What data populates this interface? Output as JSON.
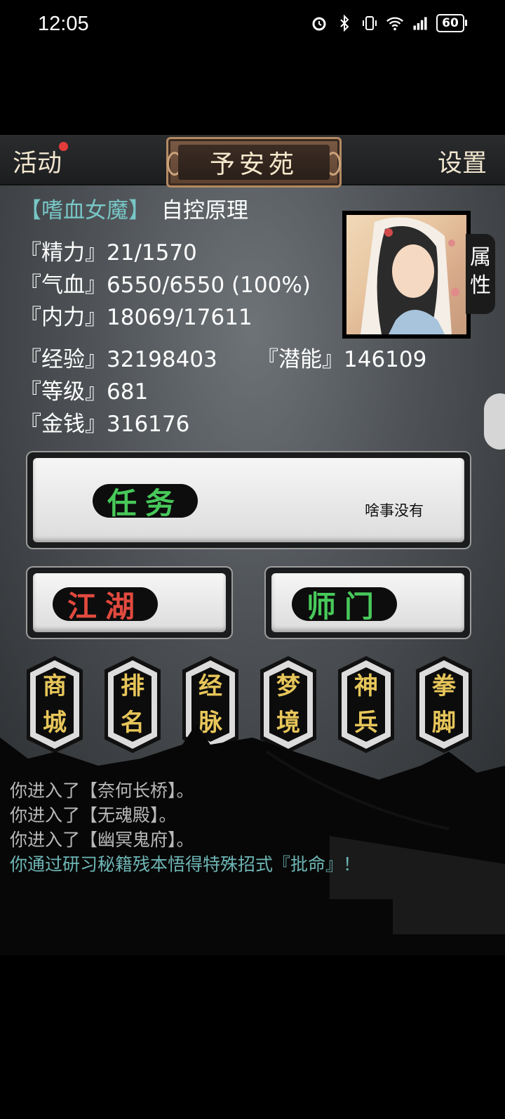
{
  "status_bar": {
    "time": "12:05",
    "battery": "60"
  },
  "topbar": {
    "left": "活动",
    "title": "予安苑",
    "right": "设置"
  },
  "profile": {
    "rank": "【嗜血女魔】",
    "sect": "自控原理",
    "stats": [
      {
        "label": "『精力』",
        "value": "21/1570"
      },
      {
        "label": "『气血』",
        "value": "6550/6550 (100%)"
      },
      {
        "label": "『内力』",
        "value": "18069/17611"
      },
      {
        "label": "『经验』",
        "value": "32198403"
      },
      {
        "label": "『潜能』",
        "value": "146109"
      },
      {
        "label": "『等级』",
        "value": "681"
      },
      {
        "label": "『金钱』",
        "value": "316176"
      }
    ],
    "attr_tab": "属性"
  },
  "task": {
    "label": "任务",
    "note": "啥事没有"
  },
  "buttons": {
    "jianghu": "江湖",
    "shimen": "师门"
  },
  "menu": [
    {
      "top": "商",
      "bottom": "城"
    },
    {
      "top": "排",
      "bottom": "名"
    },
    {
      "top": "经",
      "bottom": "脉"
    },
    {
      "top": "梦",
      "bottom": "境"
    },
    {
      "top": "神",
      "bottom": "兵"
    },
    {
      "top": "拳",
      "bottom": "脚"
    }
  ],
  "log": [
    "你进入了【奈何长桥】。",
    "你进入了【无魂殿】。",
    "你进入了【幽冥鬼府】。",
    "你通过研习秘籍残本悟得特殊招式『批命』！"
  ],
  "colors": {
    "jianghu": "#e24a3e",
    "green": "#47c95a",
    "gold": "#e7c65a",
    "rank": "#78c6c6"
  }
}
